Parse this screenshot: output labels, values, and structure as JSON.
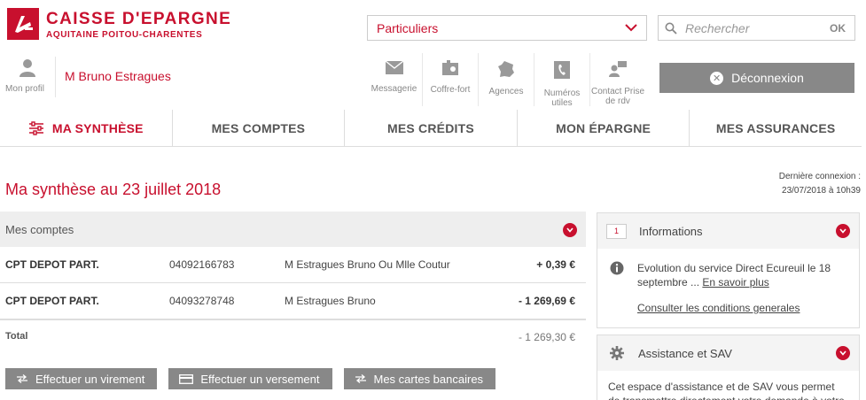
{
  "header": {
    "brand": "CAISSE D'EPARGNE",
    "region": "AQUITAINE POITOU-CHARENTES",
    "segment": {
      "selected": "Particuliers"
    },
    "search": {
      "placeholder": "Rechercher",
      "ok_label": "OK"
    },
    "profile_label": "Mon profil",
    "username": "M Bruno Estragues",
    "tools": [
      {
        "label": "Messagerie",
        "icon": "envelope-icon"
      },
      {
        "label": "Coffre-fort",
        "icon": "safe-icon"
      },
      {
        "label": "Agences",
        "icon": "map-france-icon"
      },
      {
        "label": "Numéros utiles",
        "icon": "phone-icon"
      },
      {
        "label": "Contact Prise de rdv",
        "icon": "contact-icon"
      }
    ],
    "logout_label": "Déconnexion"
  },
  "nav": [
    {
      "label": "MA SYNTHÈSE",
      "active": true
    },
    {
      "label": "MES COMPTES"
    },
    {
      "label": "MES CRÉDITS"
    },
    {
      "label": "MON ÉPARGNE"
    },
    {
      "label": "MES ASSURANCES"
    }
  ],
  "last_connection": {
    "label": "Dernière connexion :",
    "value": "23/07/2018 à 10h39"
  },
  "page_title": "Ma synthèse au 23 juillet 2018",
  "accounts": {
    "title": "Mes comptes",
    "rows": [
      {
        "type": "CPT DEPOT PART.",
        "number": "04092166783",
        "owner": "M Estragues Bruno Ou Mlle Coutur",
        "amount": "+ 0,39 €"
      },
      {
        "type": "CPT DEPOT PART.",
        "number": "04093278748",
        "owner": "M Estragues Bruno",
        "amount": "- 1 269,69 €"
      }
    ],
    "total_label": "Total",
    "total_amount": "- 1 269,30 €"
  },
  "actions": {
    "transfer": "Effectuer un virement",
    "deposit": "Effectuer un versement",
    "cards": "Mes cartes bancaires"
  },
  "informations": {
    "badge": "1",
    "title": "Informations",
    "text": "Evolution du service Direct Ecureuil le 18 septembre ...",
    "more_link": "En savoir plus",
    "conditions_link": "Consulter les conditions generales"
  },
  "sav": {
    "title": "Assistance et SAV",
    "text": "Cet espace d'assistance et de SAV vous permet de transmettre directement votre demande à votre"
  },
  "colors": {
    "brand_red": "#c8102e",
    "button_grey": "#888888"
  }
}
